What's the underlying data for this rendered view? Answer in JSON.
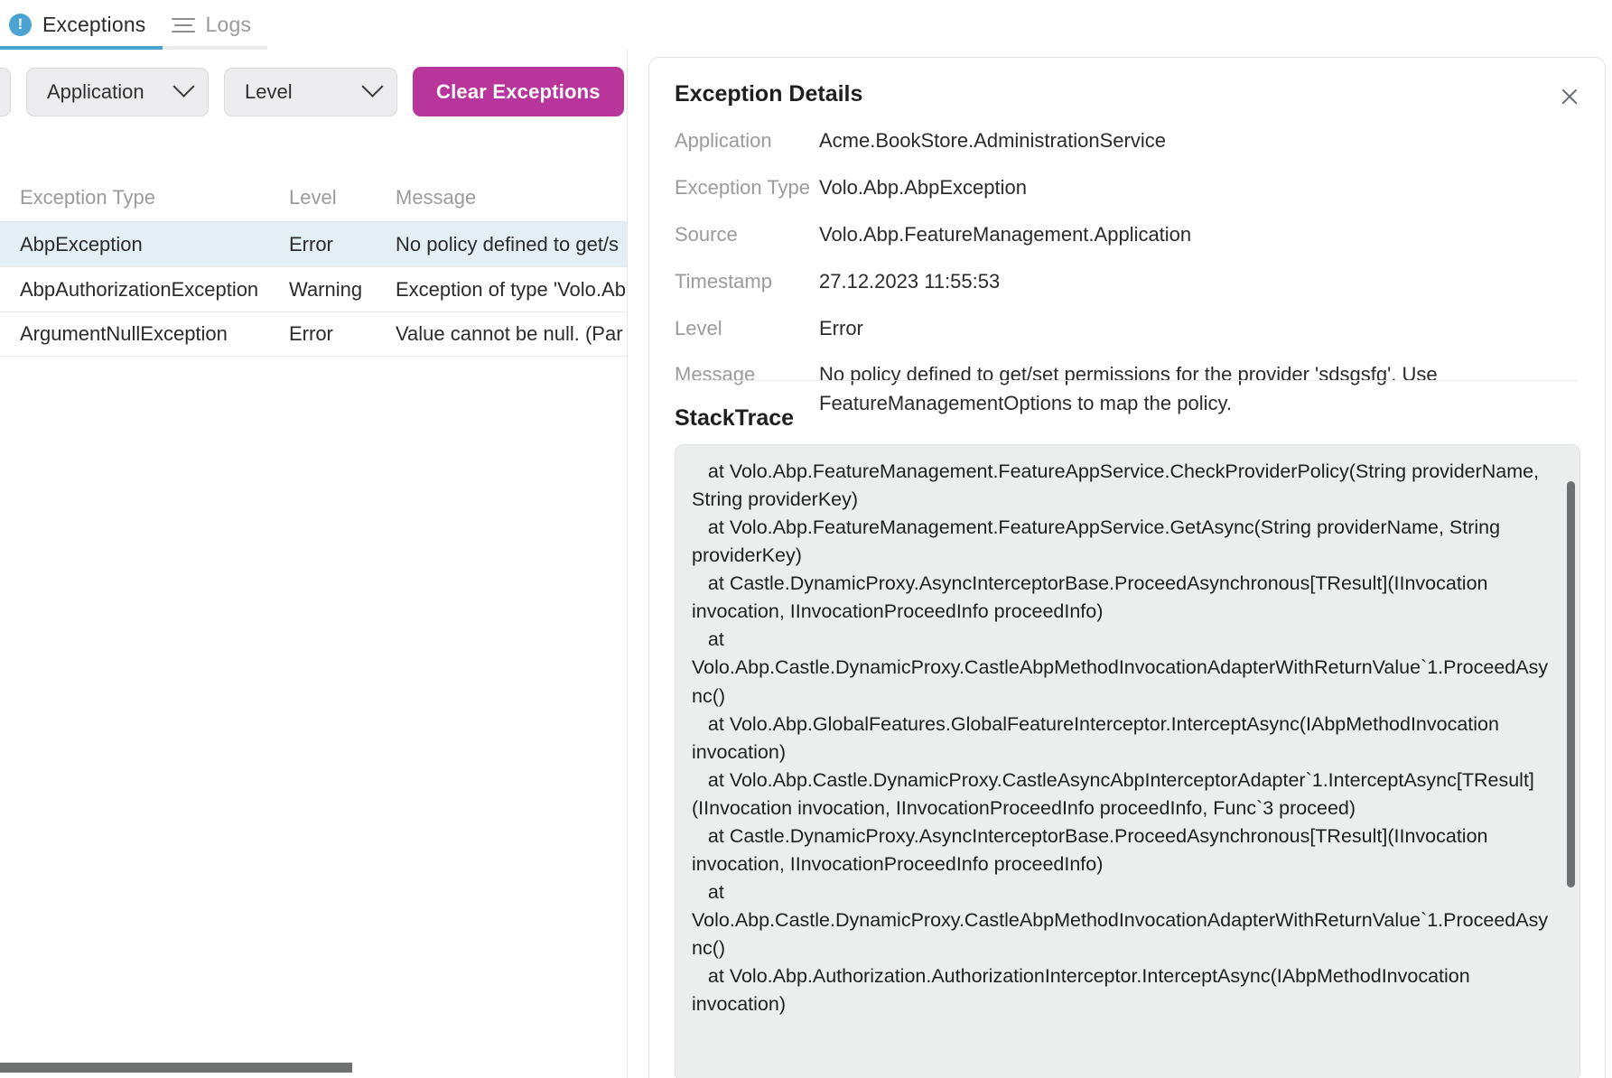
{
  "tabs": [
    {
      "label": "Exceptions",
      "icon": "alert-circle-icon",
      "active": true
    },
    {
      "label": "Logs",
      "icon": "list-icon",
      "active": false
    }
  ],
  "toolbar": {
    "application_filter": "Application",
    "level_filter": "Level",
    "clear_button": "Clear Exceptions"
  },
  "table": {
    "headers": {
      "type": "Exception Type",
      "level": "Level",
      "message": "Message"
    },
    "rows": [
      {
        "type": "AbpException",
        "level": "Error",
        "message": "No policy defined to get/s",
        "selected": true
      },
      {
        "type": "AbpAuthorizationException",
        "level": "Warning",
        "message": "Exception of type 'Volo.Abp",
        "selected": false
      },
      {
        "type": "ArgumentNullException",
        "level": "Error",
        "message": "Value cannot be null. (Par",
        "selected": false
      }
    ]
  },
  "details": {
    "title": "Exception Details",
    "close_icon": "close-icon",
    "fields": [
      {
        "label": "Application",
        "value": "Acme.BookStore.AdministrationService"
      },
      {
        "label": "Exception Type",
        "value": "Volo.Abp.AbpException"
      },
      {
        "label": "Source",
        "value": "Volo.Abp.FeatureManagement.Application"
      },
      {
        "label": "Timestamp",
        "value": "27.12.2023 11:55:53"
      },
      {
        "label": "Level",
        "value": "Error"
      },
      {
        "label": "Message",
        "value": "No policy defined to get/set permissions for the provider 'sdsgsfg'. Use FeatureManagementOptions to map the policy."
      }
    ],
    "stacktrace_title": "StackTrace",
    "stacktrace": "   at Volo.Abp.FeatureManagement.FeatureAppService.CheckProviderPolicy(String providerName, String providerKey)\n   at Volo.Abp.FeatureManagement.FeatureAppService.GetAsync(String providerName, String providerKey)\n   at Castle.DynamicProxy.AsyncInterceptorBase.ProceedAsynchronous[TResult](IInvocation invocation, IInvocationProceedInfo proceedInfo)\n   at Volo.Abp.Castle.DynamicProxy.CastleAbpMethodInvocationAdapterWithReturnValue`1.ProceedAsync()\n   at Volo.Abp.GlobalFeatures.GlobalFeatureInterceptor.InterceptAsync(IAbpMethodInvocation invocation)\n   at Volo.Abp.Castle.DynamicProxy.CastleAsyncAbpInterceptorAdapter`1.InterceptAsync[TResult](IInvocation invocation, IInvocationProceedInfo proceedInfo, Func`3 proceed)\n   at Castle.DynamicProxy.AsyncInterceptorBase.ProceedAsynchronous[TResult](IInvocation invocation, IInvocationProceedInfo proceedInfo)\n   at Volo.Abp.Castle.DynamicProxy.CastleAbpMethodInvocationAdapterWithReturnValue`1.ProceedAsync()\n   at Volo.Abp.Authorization.AuthorizationInterceptor.InterceptAsync(IAbpMethodInvocation invocation)"
  },
  "colors": {
    "accent_blue": "#4aa3d0",
    "clear_button": "#b8359c",
    "selected_row": "#e3eff4",
    "stack_bg": "#eceded",
    "scrollbar": "#6e7072"
  }
}
